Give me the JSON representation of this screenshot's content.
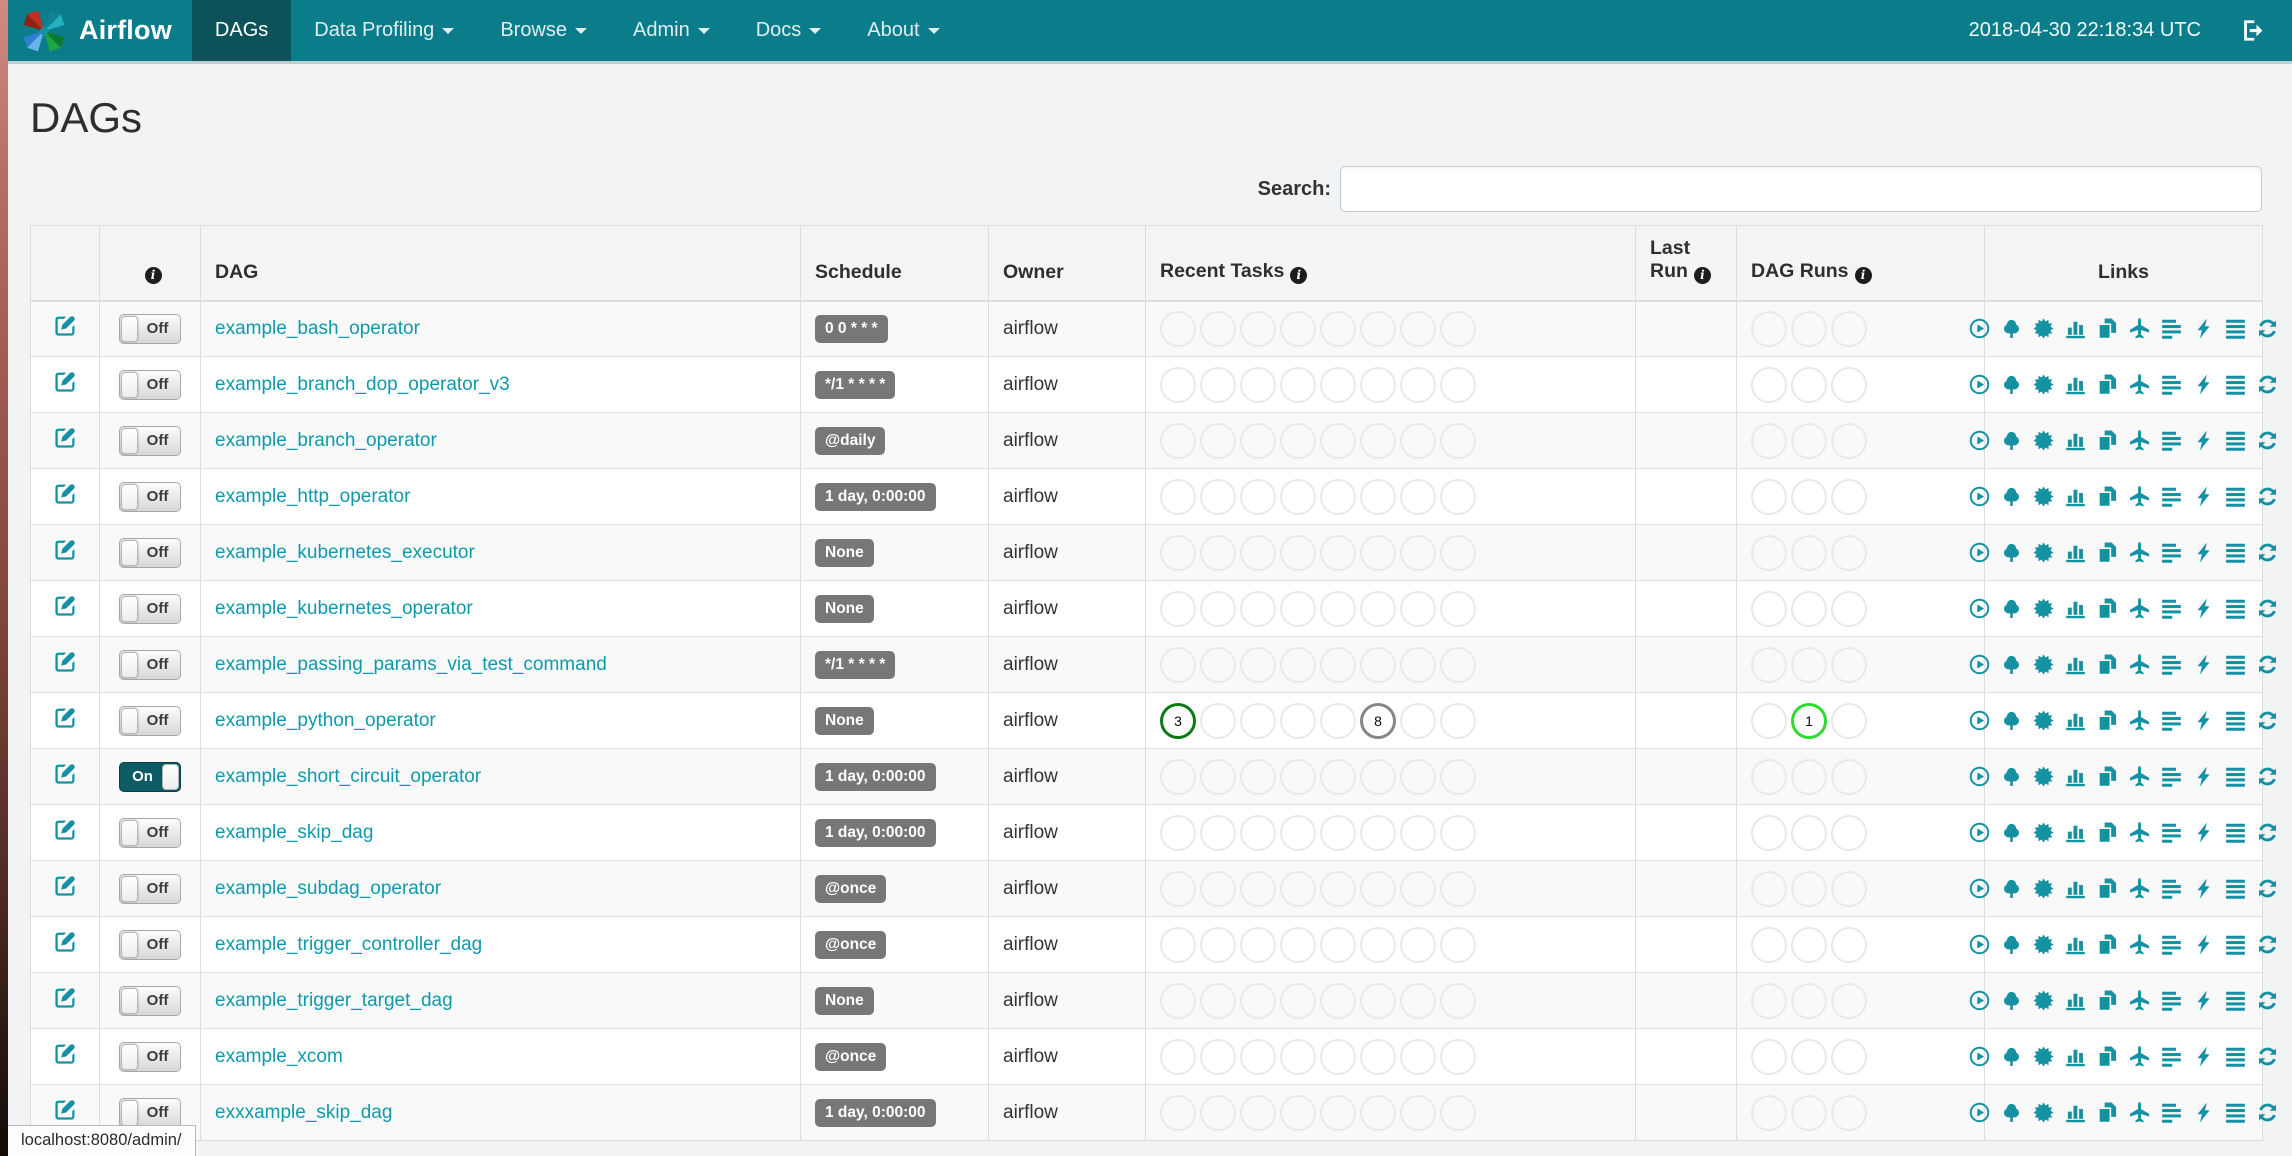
{
  "navbar": {
    "brand": "Airflow",
    "items": [
      {
        "label": "DAGs",
        "active": true,
        "caret": false
      },
      {
        "label": "Data Profiling",
        "active": false,
        "caret": true
      },
      {
        "label": "Browse",
        "active": false,
        "caret": true
      },
      {
        "label": "Admin",
        "active": false,
        "caret": true
      },
      {
        "label": "Docs",
        "active": false,
        "caret": true
      },
      {
        "label": "About",
        "active": false,
        "caret": true
      }
    ],
    "clock": "2018-04-30 22:18:34 UTC"
  },
  "page": {
    "title": "DAGs",
    "search_label": "Search:",
    "search_value": "",
    "status_bar": "localhost:8080/admin/"
  },
  "table": {
    "headers": {
      "dag": "DAG",
      "schedule": "Schedule",
      "owner": "Owner",
      "recent_tasks": "Recent Tasks",
      "last_run": "Last Run",
      "dag_runs": "DAG Runs",
      "links": "Links"
    },
    "recent_tasks_slots": 8,
    "dag_runs_slots": 3,
    "link_icons": [
      "trigger-dag",
      "tree-view",
      "graph-view",
      "task-duration",
      "task-tries",
      "landing-times",
      "gantt-view",
      "code-view",
      "task-instances",
      "refresh"
    ],
    "rows": [
      {
        "dag_id": "example_bash_operator",
        "toggle": "Off",
        "schedule": "0 0 * * *",
        "owner": "airflow",
        "recent_tasks": [],
        "last_run": "",
        "dag_runs": []
      },
      {
        "dag_id": "example_branch_dop_operator_v3",
        "toggle": "Off",
        "schedule": "*/1 * * * *",
        "owner": "airflow",
        "recent_tasks": [],
        "last_run": "",
        "dag_runs": []
      },
      {
        "dag_id": "example_branch_operator",
        "toggle": "Off",
        "schedule": "@daily",
        "owner": "airflow",
        "recent_tasks": [],
        "last_run": "",
        "dag_runs": []
      },
      {
        "dag_id": "example_http_operator",
        "toggle": "Off",
        "schedule": "1 day, 0:00:00",
        "owner": "airflow",
        "recent_tasks": [],
        "last_run": "",
        "dag_runs": []
      },
      {
        "dag_id": "example_kubernetes_executor",
        "toggle": "Off",
        "schedule": "None",
        "owner": "airflow",
        "recent_tasks": [],
        "last_run": "",
        "dag_runs": []
      },
      {
        "dag_id": "example_kubernetes_operator",
        "toggle": "Off",
        "schedule": "None",
        "owner": "airflow",
        "recent_tasks": [],
        "last_run": "",
        "dag_runs": []
      },
      {
        "dag_id": "example_passing_params_via_test_command",
        "toggle": "Off",
        "schedule": "*/1 * * * *",
        "owner": "airflow",
        "recent_tasks": [],
        "last_run": "",
        "dag_runs": []
      },
      {
        "dag_id": "example_python_operator",
        "toggle": "Off",
        "schedule": "None",
        "owner": "airflow",
        "recent_tasks": [
          {
            "slot": 0,
            "count": "3",
            "state": "success"
          },
          {
            "slot": 5,
            "count": "8",
            "state": "queued"
          }
        ],
        "last_run": "",
        "dag_runs": [
          {
            "slot": 1,
            "count": "1",
            "state": "running"
          }
        ]
      },
      {
        "dag_id": "example_short_circuit_operator",
        "toggle": "On",
        "schedule": "1 day, 0:00:00",
        "owner": "airflow",
        "recent_tasks": [],
        "last_run": "",
        "dag_runs": []
      },
      {
        "dag_id": "example_skip_dag",
        "toggle": "Off",
        "schedule": "1 day, 0:00:00",
        "owner": "airflow",
        "recent_tasks": [],
        "last_run": "",
        "dag_runs": []
      },
      {
        "dag_id": "example_subdag_operator",
        "toggle": "Off",
        "schedule": "@once",
        "owner": "airflow",
        "recent_tasks": [],
        "last_run": "",
        "dag_runs": []
      },
      {
        "dag_id": "example_trigger_controller_dag",
        "toggle": "Off",
        "schedule": "@once",
        "owner": "airflow",
        "recent_tasks": [],
        "last_run": "",
        "dag_runs": []
      },
      {
        "dag_id": "example_trigger_target_dag",
        "toggle": "Off",
        "schedule": "None",
        "owner": "airflow",
        "recent_tasks": [],
        "last_run": "",
        "dag_runs": []
      },
      {
        "dag_id": "example_xcom",
        "toggle": "Off",
        "schedule": "@once",
        "owner": "airflow",
        "recent_tasks": [],
        "last_run": "",
        "dag_runs": []
      },
      {
        "dag_id": "exxxample_skip_dag",
        "toggle": "Off",
        "schedule": "1 day, 0:00:00",
        "owner": "airflow",
        "recent_tasks": [],
        "last_run": "",
        "dag_runs": []
      }
    ]
  },
  "colors": {
    "navbar": "#0b7c89",
    "navbar_active": "#0d525b",
    "link": "#1099ab",
    "accent_icon": "#1592a2",
    "badge_bg": "#777777",
    "toggle_on_bg": "#0d5b64",
    "empty_circle": "#e9e9e9",
    "state_success": "#0a7a14",
    "state_queued": "#868686",
    "state_running": "#2edb2e"
  }
}
